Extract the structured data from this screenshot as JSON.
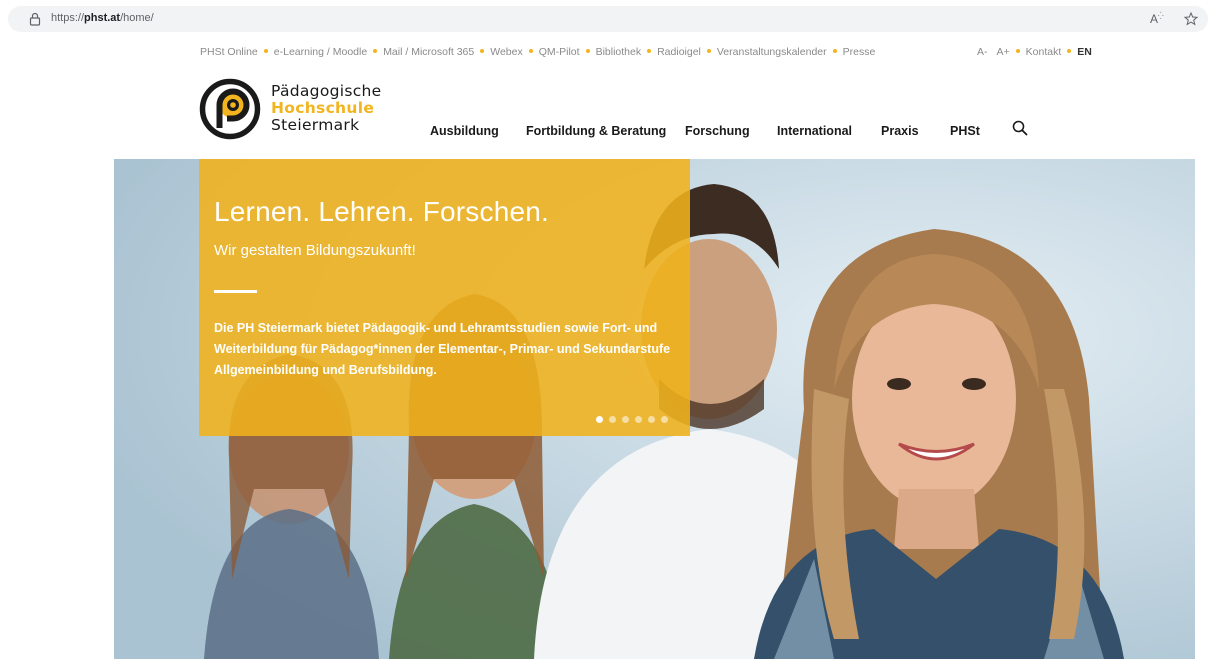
{
  "browser": {
    "url_prefix": "https://",
    "url_domain": "phst.at",
    "url_path": "/home/",
    "read_aloud_label": "A",
    "icons": [
      "lock-icon",
      "read-aloud-icon",
      "favorite-star-icon"
    ]
  },
  "utility": {
    "links": [
      "PHSt Online",
      "e-Learning / Moodle",
      "Mail / Microsoft 365",
      "Webex",
      "QM-Pilot",
      "Bibliothek",
      "Radioigel",
      "Veranstaltungskalender",
      "Presse"
    ],
    "font_smaller": "A-",
    "font_larger": "A+",
    "contact": "Kontakt",
    "language": "EN"
  },
  "logo": {
    "line1": "Pädagogische",
    "line2": "Hochschule",
    "line3": "Steiermark",
    "colors": {
      "accent": "#f2b51f",
      "dark": "#1a1a1a"
    }
  },
  "nav": {
    "items": [
      "Ausbildung",
      "Fortbildung & Beratung",
      "Forschung",
      "International",
      "Praxis",
      "PHSt"
    ]
  },
  "hero": {
    "title": "Lernen. Lehren. Forschen.",
    "subtitle": "Wir gestalten Bildungszukunft!",
    "body": "Die PH Steiermark bietet Pädagogik- und Lehramtsstudien sowie Fort- und Weiterbildung für Pädagog*innen der Elementar-, Primar- und Sekundarstufe Allgemeinbildung und Berufsbildung.",
    "slides_total": 6,
    "slide_active": 1,
    "box_color": "#f0b21b"
  }
}
